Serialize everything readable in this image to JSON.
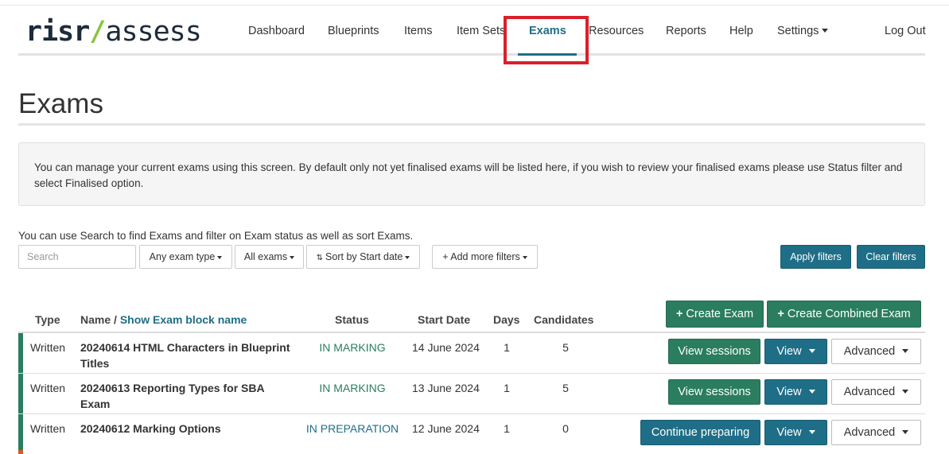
{
  "brand": {
    "part1": "risr",
    "slash": "/",
    "part2": "assess"
  },
  "nav": {
    "dashboard": "Dashboard",
    "blueprints": "Blueprints",
    "items": "Items",
    "item_sets": "Item Sets",
    "exams": "Exams",
    "resources": "Resources",
    "reports": "Reports",
    "help": "Help",
    "settings": "Settings",
    "logout": "Log Out"
  },
  "page": {
    "title": "Exams",
    "info": "You can manage your current exams using this screen. By default only not yet finalised exams will be listed here, if you wish to review your finalised exams please use Status filter and select Finalised option.",
    "hint": "You can use Search to find Exams and filter on Exam status as well as sort Exams."
  },
  "filters": {
    "search_placeholder": "Search",
    "exam_type": "Any exam type",
    "exam_status": "All exams",
    "sort": "Sort by Start date",
    "more_filters": "+ Add more filters",
    "apply": "Apply filters",
    "clear": "Clear filters"
  },
  "actions": {
    "create_exam": "Create Exam",
    "create_combined": "Create Combined Exam"
  },
  "table": {
    "headers": {
      "type": "Type",
      "name": "Name /",
      "name_link": "Show Exam block name",
      "status": "Status",
      "start_date": "Start Date",
      "days": "Days",
      "candidates": "Candidates"
    },
    "rows": [
      {
        "type": "Written",
        "name": "20240614 HTML Characters in Blueprint Titles",
        "status": "IN MARKING",
        "start_date": "14 June 2024",
        "days": "1",
        "candidates": "5",
        "primary_action": "View sessions",
        "view": "View",
        "advanced": "Advanced"
      },
      {
        "type": "Written",
        "name": "20240613 Reporting Types for SBA Exam",
        "status": "IN MARKING",
        "start_date": "13 June 2024",
        "days": "1",
        "candidates": "5",
        "primary_action": "View sessions",
        "view": "View",
        "advanced": "Advanced"
      },
      {
        "type": "Written",
        "name": "20240612 Marking Options",
        "status": "IN PREPARATION",
        "start_date": "12 June 2024",
        "days": "1",
        "candidates": "0",
        "primary_action": "Continue preparing",
        "view": "View",
        "advanced": "Advanced"
      }
    ]
  },
  "colors": {
    "primary": "#1f6e87",
    "success": "#2b7d60",
    "highlight": "#d9202a",
    "logo_slash": "#8bc53f"
  }
}
